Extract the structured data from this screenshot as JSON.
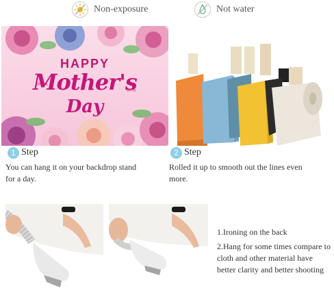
{
  "features": [
    {
      "icon": "sun-icon",
      "label": "Non-exposure"
    },
    {
      "icon": "water-drop-icon",
      "label": "Not water"
    }
  ],
  "banner": {
    "line1": "HAPPY",
    "line2": "Mother's",
    "line3": "Day"
  },
  "steps": [
    {
      "number": "1",
      "title": "Step",
      "text": "You can hang it on your backdrop stand for a day."
    },
    {
      "number": "2",
      "title": "Step",
      "text": "Rolled it up to smooth out the lines even more."
    }
  ],
  "instructions": [
    "1.Ironing on the back",
    "2.Hang for some times compare to cloth and other material have better clarity and better shooting"
  ],
  "colors": {
    "accent_pink": "#c4167a",
    "step_badge": "#8fcfe6"
  }
}
